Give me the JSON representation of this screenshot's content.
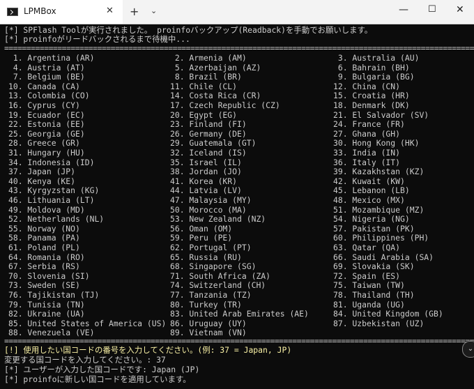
{
  "window": {
    "tab_title": "LPMBox",
    "tab_close": "✕",
    "new_tab": "+",
    "tab_dropdown": "⌄",
    "minimize": "—",
    "maximize": "☐",
    "close": "✕"
  },
  "console": {
    "line1": "[*] SPFlash Toolが実行されました。 proinfoバックアップ(Readback)を手動でお願いします。",
    "line2": "[*] proinfoがリードバックされるまで待機中...",
    "separator_top": "=====================================================================================================================",
    "separator_bottom": "=====================================================================================================================",
    "prompt": "[!] 使用したい国コードの番号を入力してください。(例: 37 = Japan, JP)",
    "input_line": "変更する国コードを入力してください。: 37",
    "confirm_line": "[*] ユーザーが入力した国コードです: Japan (JP)",
    "apply_line": "[*] proinfoに新しい国コードを適用しています。"
  },
  "countries": [
    [
      "1. Argentina (AR)",
      "2. Armenia (AM)",
      "3. Australia (AU)"
    ],
    [
      "4. Austria (AT)",
      "5. Azerbaijan (AZ)",
      "6. Bahrain (BH)"
    ],
    [
      "7. Belgium (BE)",
      "8. Brazil (BR)",
      "9. Bulgaria (BG)"
    ],
    [
      "10. Canada (CA)",
      "11. Chile (CL)",
      "12. China (CN)"
    ],
    [
      "13. Colombia (CO)",
      "14. Costa Rica (CR)",
      "15. Croatia (HR)"
    ],
    [
      "16. Cyprus (CY)",
      "17. Czech Republic (CZ)",
      "18. Denmark (DK)"
    ],
    [
      "19. Ecuador (EC)",
      "20. Egypt (EG)",
      "21. El Salvador (SV)"
    ],
    [
      "22. Estonia (EE)",
      "23. Finland (FI)",
      "24. France (FR)"
    ],
    [
      "25. Georgia (GE)",
      "26. Germany (DE)",
      "27. Ghana (GH)"
    ],
    [
      "28. Greece (GR)",
      "29. Guatemala (GT)",
      "30. Hong Kong (HK)"
    ],
    [
      "31. Hungary (HU)",
      "32. Iceland (IS)",
      "33. India (IN)"
    ],
    [
      "34. Indonesia (ID)",
      "35. Israel (IL)",
      "36. Italy (IT)"
    ],
    [
      "37. Japan (JP)",
      "38. Jordan (JO)",
      "39. Kazakhstan (KZ)"
    ],
    [
      "40. Kenya (KE)",
      "41. Korea (KR)",
      "42. Kuwait (KW)"
    ],
    [
      "43. Kyrgyzstan (KG)",
      "44. Latvia (LV)",
      "45. Lebanon (LB)"
    ],
    [
      "46. Lithuania (LT)",
      "47. Malaysia (MY)",
      "48. Mexico (MX)"
    ],
    [
      "49. Moldova (MD)",
      "50. Morocco (MA)",
      "51. Mozambique (MZ)"
    ],
    [
      "52. Netherlands (NL)",
      "53. New Zealand (NZ)",
      "54. Nigeria (NG)"
    ],
    [
      "55. Norway (NO)",
      "56. Oman (OM)",
      "57. Pakistan (PK)"
    ],
    [
      "58. Panama (PA)",
      "59. Peru (PE)",
      "60. Philippines (PH)"
    ],
    [
      "61. Poland (PL)",
      "62. Portugal (PT)",
      "63. Qatar (QA)"
    ],
    [
      "64. Romania (RO)",
      "65. Russia (RU)",
      "66. Saudi Arabia (SA)"
    ],
    [
      "67. Serbia (RS)",
      "68. Singapore (SG)",
      "69. Slovakia (SK)"
    ],
    [
      "70. Slovenia (SI)",
      "71. South Africa (ZA)",
      "72. Spain (ES)"
    ],
    [
      "73. Sweden (SE)",
      "74. Switzerland (CH)",
      "75. Taiwan (TW)"
    ],
    [
      "76. Tajikistan (TJ)",
      "77. Tanzania (TZ)",
      "78. Thailand (TH)"
    ],
    [
      "79. Tunisia (TN)",
      "80. Turkey (TR)",
      "81. Uganda (UG)"
    ],
    [
      "82. Ukraine (UA)",
      "83. United Arab Emirates (AE)",
      "84. United Kingdom (GB)"
    ],
    [
      "85. United States of America (US)",
      "86. Uruguay (UY)",
      "87. Uzbekistan (UZ)"
    ],
    [
      "88. Venezuela (VE)",
      "89. Vietnam (VN)",
      ""
    ]
  ],
  "scroll_button": "⌄"
}
